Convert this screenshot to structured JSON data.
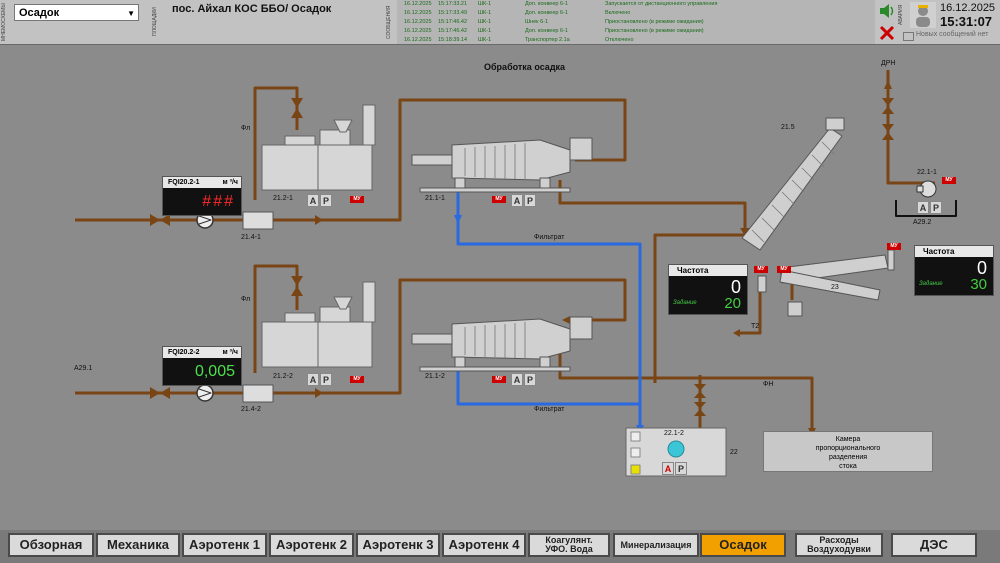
{
  "header": {
    "side_labels": [
      "МНЕМОСХЕМЫ",
      "ПЛОЩАДКИ",
      "СООБЩЕНИЯ",
      "АВАРИЯ"
    ],
    "screen_select": "Осадок",
    "location": "пос. Айхал КОС ББО/ Осадок",
    "date": "16.12.2025",
    "time": "15:31:07",
    "no_messages": "Новых сообщений нет",
    "log": [
      {
        "date": "16.12.2025",
        "time": "15:17:33.21",
        "src": "ШК-1",
        "obj": "Доп. конвеер 6-1",
        "msg": "Запускается от дистанционного управления"
      },
      {
        "date": "16.12.2025",
        "time": "15:17:33.49",
        "src": "ШК-1",
        "obj": "Доп. конвеер 6-1",
        "msg": "Включено"
      },
      {
        "date": "16.12.2025",
        "time": "15:17:46.42",
        "src": "ШК-1",
        "obj": "Шнек 6-1",
        "msg": "Приостановлено (в режиме ожидания)"
      },
      {
        "date": "16.12.2025",
        "time": "15:17:46.42",
        "src": "ШК-1",
        "obj": "Доп. конвеер 6-1",
        "msg": "Приостановлено (в режиме ожидания)"
      },
      {
        "date": "16.12.2025",
        "time": "15:18:39.14",
        "src": "ШК-1",
        "obj": "Транспортер 2.1а",
        "msg": "Отключено"
      }
    ]
  },
  "scheme": {
    "title": "Обработка осадка",
    "labels": {
      "fl1": "Фл",
      "fl2": "Фл",
      "drn": "ДРН",
      "fn": "ФН",
      "t2": "Т2",
      "a291": "А29.1",
      "filtrat1": "Фильтрат",
      "filtrat2": "Фильтрат",
      "u2121": "21.2-1",
      "u2111": "21.1-1",
      "u2122": "21.2-2",
      "u2112": "21.1-2",
      "u2141": "21.4-1",
      "u2142": "21.4-2",
      "u215": "21.5",
      "u23": "23",
      "u2211": "22.1-1",
      "a292": "А29.2",
      "u2212": "22.1-2",
      "u22": "22"
    },
    "ap": {
      "a": "А",
      "p": "Р"
    },
    "mu": "МУ",
    "flow1": {
      "name": "FQI20.2-1",
      "unit": "м ³/ч",
      "value": "###"
    },
    "flow2": {
      "name": "FQI20.2-2",
      "unit": "м ³/ч",
      "value": "0,005"
    },
    "freq1": {
      "title": "Частота",
      "value": "0",
      "task_label": "Задание",
      "task_value": "20"
    },
    "freq2": {
      "title": "Частота",
      "value": "0",
      "task_label": "Задание",
      "task_value": "30"
    },
    "camera": [
      "Камера",
      "пропорционального",
      "разделения",
      "стока"
    ]
  },
  "nav": {
    "items": [
      "Обзорная",
      "Механика",
      "Аэротенк 1",
      "Аэротенк 2",
      "Аэротенк 3",
      "Аэротенк 4"
    ],
    "koag": [
      "Коагулянт.",
      "УФО. Вода"
    ],
    "mineral": "Минерализация",
    "active": "Осадок",
    "rashody": [
      "Расходы",
      "Воздуходувки"
    ],
    "des": "ДЭС"
  },
  "colors": {
    "pipe": "#7a4515",
    "filtrat": "#2a6ae0",
    "active": "#f2a000",
    "alarm": "#cc0000"
  }
}
